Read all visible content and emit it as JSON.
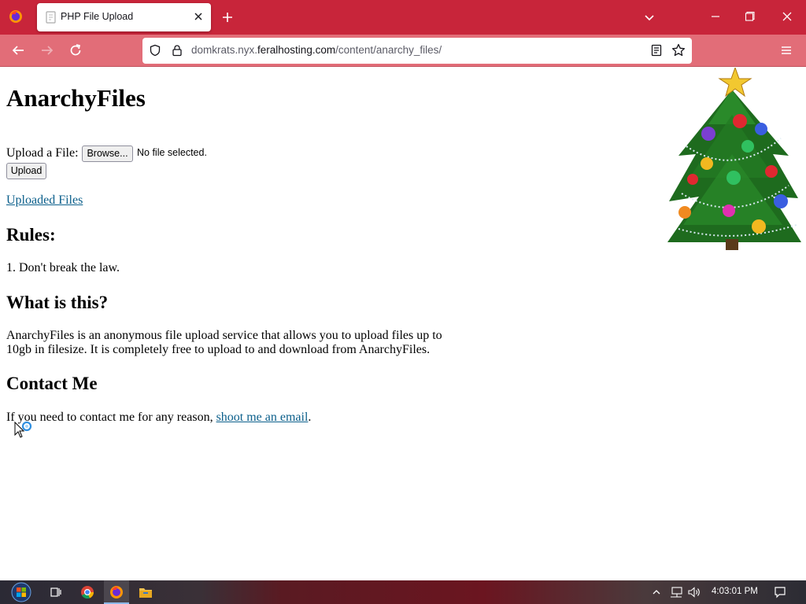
{
  "browser": {
    "tab_title": "PHP File Upload",
    "url_prefix": "domkrats.nyx.",
    "url_domain": "feralhosting.com",
    "url_path": "/content/anarchy_files/",
    "accent_color": "#c8253a",
    "toolbar_color": "#e26d78"
  },
  "page": {
    "title": "AnarchyFiles",
    "upload_label": "Upload a File:",
    "browse_label": "Browse...",
    "no_file_text": "No file selected.",
    "upload_button": "Upload",
    "uploaded_files_link": "Uploaded Files",
    "rules_heading": "Rules:",
    "rule_1": "1. Don't break the law.",
    "what_heading": "What is this?",
    "what_text": "AnarchyFiles is an anonymous file upload service that allows you to upload files up to 10gb in filesize. It is completely free to upload to and download from AnarchyFiles.",
    "contact_heading": "Contact Me",
    "contact_text_before": "If you need to contact me for any reason, ",
    "contact_link": "shoot me an email",
    "contact_text_after": ".",
    "link_color": "#0b5f8b"
  },
  "taskbar": {
    "time": "4:03:01 PM",
    "apps": [
      "start-icon",
      "task-view-icon",
      "chrome-icon",
      "firefox-icon",
      "file-explorer-icon"
    ]
  }
}
